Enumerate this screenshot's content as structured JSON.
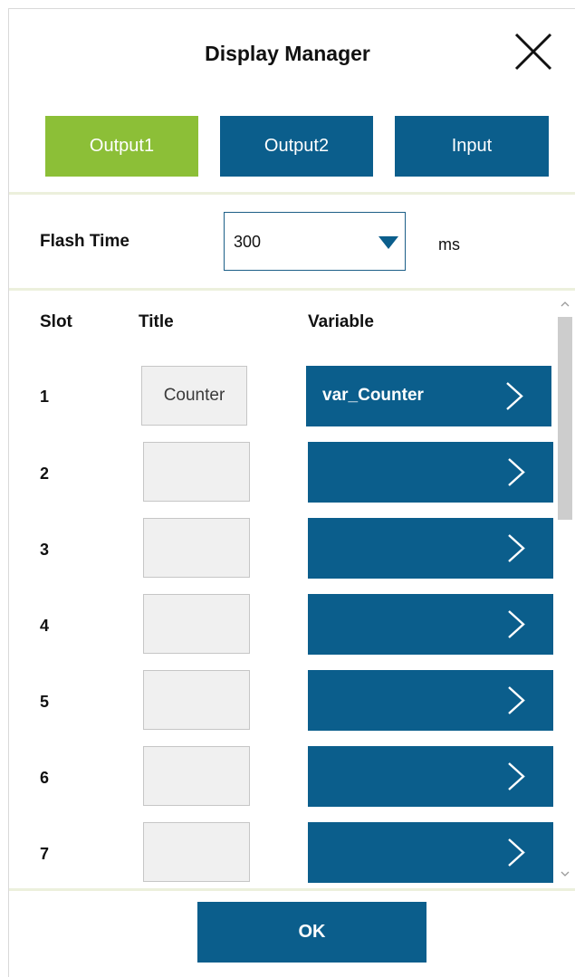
{
  "dialog": {
    "title": "Display Manager",
    "close_icon": "close-x-icon"
  },
  "tabs": [
    {
      "label": "Output1",
      "active": true
    },
    {
      "label": "Output2",
      "active": false
    },
    {
      "label": "Input",
      "active": false
    }
  ],
  "flash_time": {
    "label": "Flash Time",
    "value": "300",
    "unit": "ms"
  },
  "table": {
    "headers": {
      "slot": "Slot",
      "title": "Title",
      "variable": "Variable"
    },
    "rows": [
      {
        "slot": "1",
        "title": "Counter",
        "variable": "var_Counter"
      },
      {
        "slot": "2",
        "title": "",
        "variable": ""
      },
      {
        "slot": "3",
        "title": "",
        "variable": ""
      },
      {
        "slot": "4",
        "title": "",
        "variable": ""
      },
      {
        "slot": "5",
        "title": "",
        "variable": ""
      },
      {
        "slot": "6",
        "title": "",
        "variable": ""
      },
      {
        "slot": "7",
        "title": "",
        "variable": ""
      }
    ]
  },
  "ok_label": "OK",
  "colors": {
    "accent_green": "#8cbf37",
    "primary_blue": "#0b5e8c",
    "separator": "#ecf0dc"
  }
}
